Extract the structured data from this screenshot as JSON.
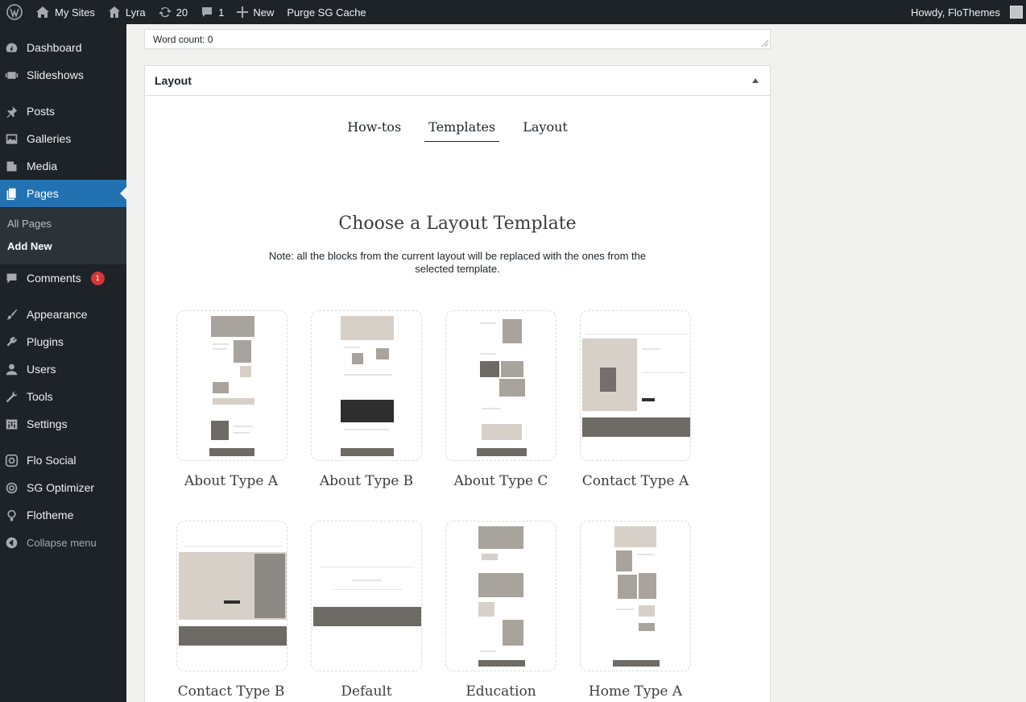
{
  "adminbar": {
    "my_sites": "My Sites",
    "site_name": "Lyra",
    "updates_count": "20",
    "comments_count": "1",
    "new_label": "New",
    "purge_label": "Purge SG Cache",
    "howdy": "Howdy, FloThemes"
  },
  "sidebar": {
    "items": [
      {
        "label": "Dashboard",
        "icon": "dashboard-icon"
      },
      {
        "label": "Slideshows",
        "icon": "slideshow-icon"
      },
      {
        "label": "Posts",
        "icon": "pin-icon"
      },
      {
        "label": "Galleries",
        "icon": "gallery-icon"
      },
      {
        "label": "Media",
        "icon": "media-icon"
      },
      {
        "label": "Pages",
        "icon": "pages-icon"
      },
      {
        "label": "Comments",
        "icon": "comment-icon",
        "badge": "1"
      },
      {
        "label": "Appearance",
        "icon": "brush-icon"
      },
      {
        "label": "Plugins",
        "icon": "plugin-icon"
      },
      {
        "label": "Users",
        "icon": "user-icon"
      },
      {
        "label": "Tools",
        "icon": "wrench-icon"
      },
      {
        "label": "Settings",
        "icon": "settings-icon"
      },
      {
        "label": "Flo Social",
        "icon": "instagram-icon"
      },
      {
        "label": "SG Optimizer",
        "icon": "sg-icon"
      },
      {
        "label": "Flotheme",
        "icon": "bulb-icon"
      }
    ],
    "submenu": {
      "all_pages": "All Pages",
      "add_new": "Add New"
    },
    "collapse": "Collapse menu"
  },
  "editor": {
    "word_count": "Word count: 0"
  },
  "layout_box": {
    "title": "Layout",
    "tabs": [
      "How-tos",
      "Templates",
      "Layout"
    ],
    "active_tab": "Templates",
    "heading": "Choose a Layout Template",
    "note": "Note: all the blocks from the current layout will be replaced with the ones from the selected template.",
    "templates": [
      "About Type A",
      "About Type B",
      "About Type C",
      "Contact Type A",
      "Contact Type B",
      "Default",
      "Education",
      "Home Type A"
    ]
  },
  "colors": {
    "admin_bg": "#1d2327",
    "accent": "#2271b1",
    "badge": "#d63638"
  }
}
